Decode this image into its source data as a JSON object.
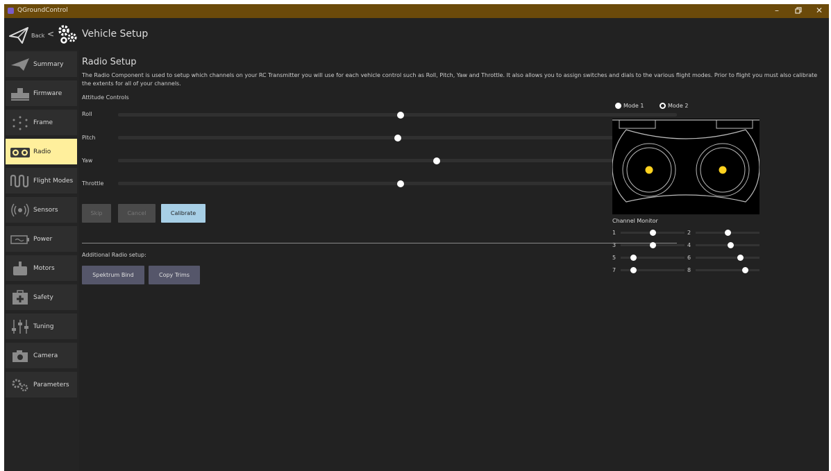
{
  "window": {
    "title": "QGroundControl"
  },
  "header": {
    "back_label": "Back",
    "back_arrow": "<",
    "title": "Vehicle Setup"
  },
  "sidebar": {
    "items": [
      {
        "label": "Summary",
        "icon": "paper-plane-icon"
      },
      {
        "label": "Firmware",
        "icon": "firmware-icon"
      },
      {
        "label": "Frame",
        "icon": "frame-icon"
      },
      {
        "label": "Radio",
        "icon": "radio-icon",
        "active": true
      },
      {
        "label": "Flight Modes",
        "icon": "flight-modes-icon"
      },
      {
        "label": "Sensors",
        "icon": "sensors-icon"
      },
      {
        "label": "Power",
        "icon": "battery-icon"
      },
      {
        "label": "Motors",
        "icon": "motors-icon"
      },
      {
        "label": "Safety",
        "icon": "safety-icon"
      },
      {
        "label": "Tuning",
        "icon": "tuning-icon"
      },
      {
        "label": "Camera",
        "icon": "camera-icon"
      },
      {
        "label": "Parameters",
        "icon": "gears-icon"
      }
    ]
  },
  "main": {
    "title": "Radio Setup",
    "description": "The Radio Component is used to setup which channels on your RC Transmitter you will use for each vehicle control such as Roll, Pitch, Yaw and Throttle. It also allows you to assign switches and dials to the various flight modes. Prior to flight you must also calibrate the extents for all of your channels.",
    "attitude_label": "Attitude Controls",
    "controls": [
      {
        "label": "Roll",
        "value": 0.505
      },
      {
        "label": "Pitch",
        "value": 0.5
      },
      {
        "label": "Yaw",
        "value": 0.57
      },
      {
        "label": "Throttle",
        "value": 0.505
      }
    ],
    "buttons": {
      "skip": "Skip",
      "cancel": "Cancel",
      "calibrate": "Calibrate"
    },
    "additional_label": "Additional Radio setup:",
    "spektrum_bind": "Spektrum Bind",
    "copy_trims": "Copy Trims"
  },
  "right": {
    "mode1": "Mode 1",
    "mode2": "Mode 2",
    "selected_mode": "Mode 2",
    "channel_monitor_label": "Channel Monitor",
    "channels": [
      {
        "num": "1",
        "value": 0.5
      },
      {
        "num": "2",
        "value": 0.5
      },
      {
        "num": "3",
        "value": 0.5
      },
      {
        "num": "4",
        "value": 0.55
      },
      {
        "num": "5",
        "value": 0.2
      },
      {
        "num": "6",
        "value": 0.7
      },
      {
        "num": "7",
        "value": 0.2
      },
      {
        "num": "8",
        "value": 0.78
      }
    ]
  },
  "colors": {
    "active_item": "#ffef9c",
    "calibrate_button": "#a7cfe6",
    "stick_dot": "#ffd21f"
  }
}
